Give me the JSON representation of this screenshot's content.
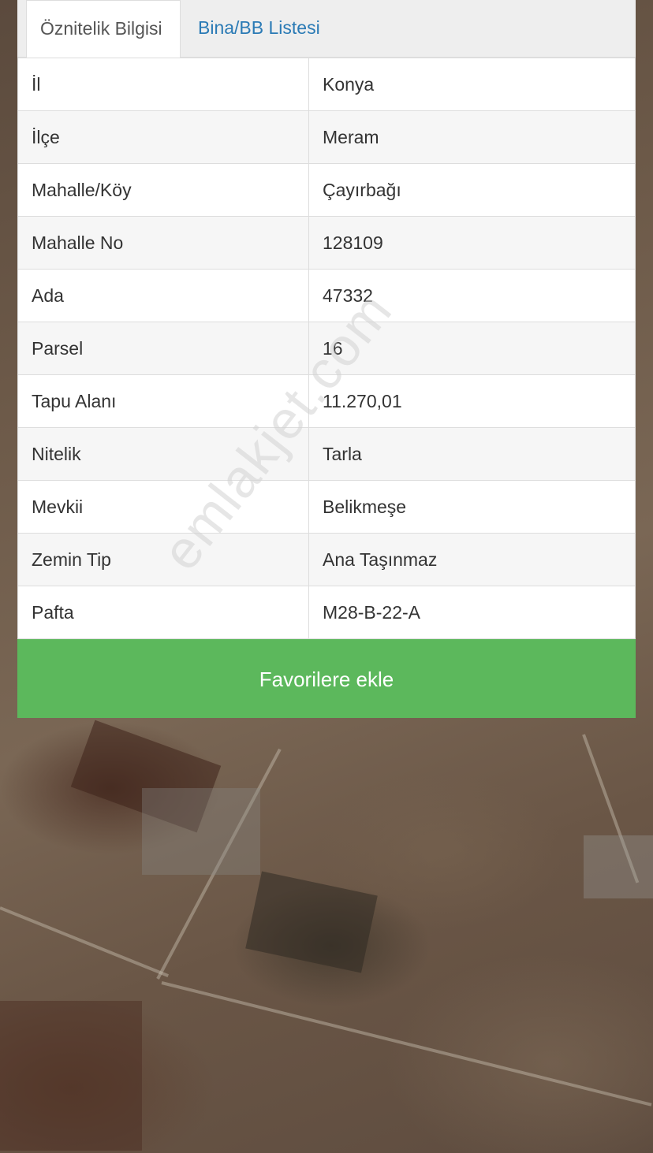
{
  "tabs": {
    "active_label": "Öznitelik Bilgisi",
    "inactive_label": "Bina/BB Listesi"
  },
  "attributes": [
    {
      "label": "İl",
      "value": "Konya"
    },
    {
      "label": "İlçe",
      "value": "Meram"
    },
    {
      "label": "Mahalle/Köy",
      "value": "Çayırbağı"
    },
    {
      "label": "Mahalle No",
      "value": "128109"
    },
    {
      "label": "Ada",
      "value": "47332"
    },
    {
      "label": "Parsel",
      "value": "16"
    },
    {
      "label": "Tapu Alanı",
      "value": "11.270,01"
    },
    {
      "label": "Nitelik",
      "value": "Tarla"
    },
    {
      "label": "Mevkii",
      "value": "Belikmeşe"
    },
    {
      "label": "Zemin Tip",
      "value": "Ana Taşınmaz"
    },
    {
      "label": "Pafta",
      "value": "M28-B-22-A"
    }
  ],
  "favorite_button_label": "Favorilere ekle",
  "watermark_text": "emlakjet.com",
  "colors": {
    "tab_link": "#2a7ab5",
    "button_green": "#5cb85c"
  }
}
